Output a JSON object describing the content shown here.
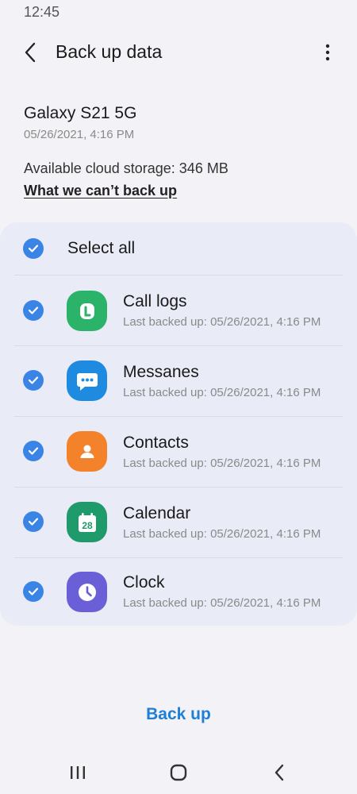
{
  "status": {
    "time": "12:45"
  },
  "header": {
    "title": "Back up data"
  },
  "device": {
    "name": "Galaxy S21 5G",
    "date": "05/26/2021, 4:16 PM",
    "storage": "Available cloud storage: 346 MB",
    "cant_backup_link": "What we can’t back up"
  },
  "list": {
    "select_all_label": "Select all",
    "items": [
      {
        "title": "Call logs",
        "subtitle": "Last backed up: 05/26/2021, 4:16 PM",
        "icon": "phone-icon",
        "color": "#2bb36a",
        "checked": true
      },
      {
        "title": "Messanes",
        "subtitle": "Last backed up: 05/26/2021, 4:16 PM",
        "icon": "messages-icon",
        "color": "#1f8be0",
        "checked": true
      },
      {
        "title": "Contacts",
        "subtitle": "Last backed up: 05/26/2021, 4:16 PM",
        "icon": "contacts-icon",
        "color": "#f4822b",
        "checked": true
      },
      {
        "title": "Calendar",
        "subtitle": "Last backed up: 05/26/2021, 4:16 PM",
        "icon": "calendar-icon",
        "color": "#1f9a6a",
        "checked": true,
        "icon_text": "28"
      },
      {
        "title": "Clock",
        "subtitle": "Last backed up: 05/26/2021, 4:16 PM",
        "icon": "clock-icon",
        "color": "#6a5fd6",
        "checked": true
      }
    ]
  },
  "footer": {
    "backup_label": "Back up"
  },
  "nav": {
    "recents_icon": "recents-icon",
    "home_icon": "home-icon",
    "back_icon": "back-icon"
  },
  "colors": {
    "accent": "#3a84e6",
    "link_blue": "#1f7fd6",
    "card_bg": "#e9ebf6",
    "page_bg": "#f3f2f6"
  }
}
